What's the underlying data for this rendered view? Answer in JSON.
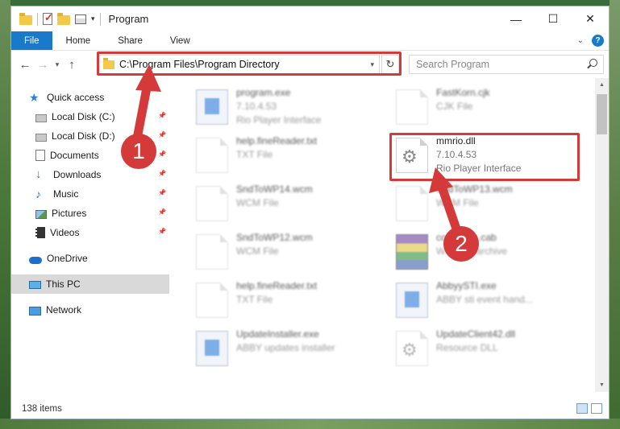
{
  "window": {
    "title": "Program"
  },
  "controls": {
    "minimize": "—",
    "maximize": "☐",
    "close": "✕"
  },
  "ribbon": {
    "tabs": [
      "File",
      "Home",
      "Share",
      "View"
    ],
    "help": "?"
  },
  "nav": {
    "back": "←",
    "forward": "→",
    "recent": "▾",
    "up": "↑"
  },
  "address": {
    "path": "C:\\Program Files\\Program Directory",
    "refresh": "↻"
  },
  "search": {
    "placeholder": "Search Program"
  },
  "sidebar": {
    "items": [
      {
        "label": "Quick access",
        "icon": "star-icon",
        "pinned": false
      },
      {
        "label": "Local Disk (C:)",
        "icon": "disk-icon",
        "pinned": true
      },
      {
        "label": "Local Disk (D:)",
        "icon": "disk-icon",
        "pinned": true
      },
      {
        "label": "Documents",
        "icon": "documents-icon",
        "pinned": true
      },
      {
        "label": "Downloads",
        "icon": "downloads-icon",
        "pinned": true
      },
      {
        "label": "Music",
        "icon": "music-icon",
        "pinned": true
      },
      {
        "label": "Pictures",
        "icon": "pictures-icon",
        "pinned": true
      },
      {
        "label": "Videos",
        "icon": "videos-icon",
        "pinned": true
      },
      {
        "label": "OneDrive",
        "icon": "onedrive-icon",
        "pinned": false
      },
      {
        "label": "This PC",
        "icon": "this-pc-icon",
        "pinned": false,
        "selected": true
      },
      {
        "label": "Network",
        "icon": "network-icon",
        "pinned": false
      }
    ]
  },
  "files": [
    {
      "name": "program.exe",
      "line2": "7.10.4.53",
      "line3": "Rio Player Interface",
      "icon": "exe-icon",
      "blurred": true
    },
    {
      "name": "FastKorn.cjk",
      "line2": "CJK File",
      "line3": "",
      "icon": "page-icon",
      "blurred": true
    },
    {
      "name": "help.fineReader.txt",
      "line2": "TXT File",
      "line3": "",
      "icon": "page-icon",
      "blurred": true
    },
    {
      "name": "mmrio.dll",
      "line2": "7.10.4.53",
      "line3": "Rio Player Interface",
      "icon": "dll-icon",
      "blurred": false
    },
    {
      "name": "SndToWP14.wcm",
      "line2": "WCM File",
      "line3": "",
      "icon": "page-icon",
      "blurred": true
    },
    {
      "name": "SndToWP13.wcm",
      "line2": "WCM File",
      "line3": "",
      "icon": "page-icon",
      "blurred": true
    },
    {
      "name": "SndToWP12.wcm",
      "line2": "WCM File",
      "line3": "",
      "icon": "page-icon",
      "blurred": true
    },
    {
      "name": "coretypes.cab",
      "line2": "WinRAR archive",
      "line3": "",
      "icon": "cab-icon",
      "blurred": true
    },
    {
      "name": "help.fineReader.txt",
      "line2": "TXT File",
      "line3": "",
      "icon": "page-icon",
      "blurred": true
    },
    {
      "name": "AbbyySTI.exe",
      "line2": "ABBY sti event hand...",
      "line3": "",
      "icon": "exe-icon",
      "blurred": true
    },
    {
      "name": "UpdateInstaller.exe",
      "line2": "ABBY updates installer",
      "line3": "",
      "icon": "exe-icon",
      "blurred": true
    },
    {
      "name": "UpdateClient42.dll",
      "line2": "Resource DLL",
      "line3": "",
      "icon": "dll-icon",
      "blurred": true
    }
  ],
  "status": {
    "item_count": "138 items"
  },
  "annotations": {
    "step1": "1",
    "step2": "2",
    "accent": "#d43a3a"
  }
}
